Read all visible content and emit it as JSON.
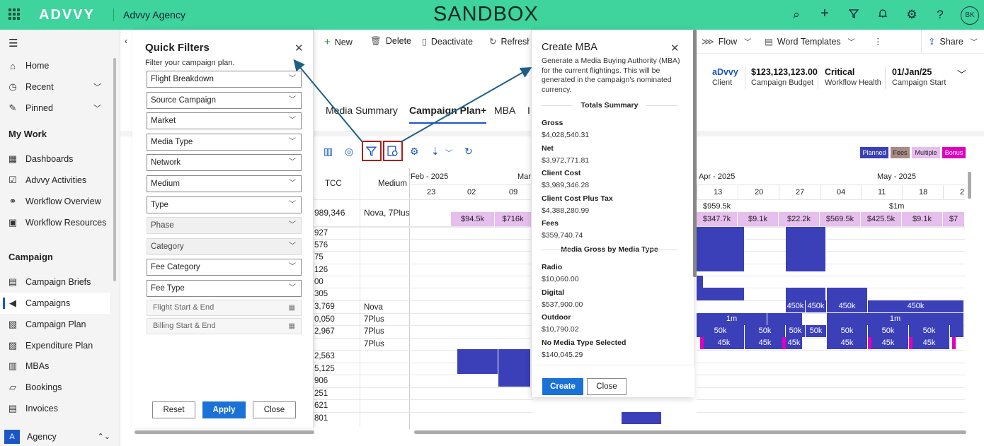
{
  "topbar": {
    "logo": "ADVVY",
    "agency": "Advvy Agency",
    "env": "SANDBOX",
    "avatar": "BK",
    "icons": [
      "search-icon",
      "add-icon",
      "filter-icon",
      "bell-icon",
      "settings-icon",
      "help-icon"
    ]
  },
  "nav": {
    "items": [
      {
        "label": "Home",
        "icon": "⌂"
      },
      {
        "label": "Recent",
        "icon": "◷"
      },
      {
        "label": "Pinned",
        "icon": "✎"
      }
    ],
    "my_work": "My Work",
    "work_items": [
      {
        "label": "Dashboards",
        "icon": "▦"
      },
      {
        "label": "Advvy Activities",
        "icon": "☑"
      },
      {
        "label": "Workflow Overview",
        "icon": "⚭"
      },
      {
        "label": "Workflow Resources",
        "icon": "▣"
      }
    ],
    "campaign": "Campaign",
    "campaign_items": [
      {
        "label": "Campaign Briefs",
        "icon": "▤"
      },
      {
        "label": "Campaigns",
        "icon": "📢"
      },
      {
        "label": "Campaign Plan",
        "icon": "▧"
      },
      {
        "label": "Expenditure Plan",
        "icon": "▨"
      },
      {
        "label": "MBAs",
        "icon": "▥"
      },
      {
        "label": "Bookings",
        "icon": "▱"
      },
      {
        "label": "Invoices",
        "icon": "▤"
      }
    ],
    "area": "Agency",
    "area_letter": "A"
  },
  "quick_filters": {
    "title": "Quick Filters",
    "subtitle": "Filter your campaign plan.",
    "selects": [
      "Flight Breakdown",
      "Source Campaign",
      "Market",
      "Media Type",
      "Network",
      "Medium",
      "Type",
      "Phase",
      "Category",
      "Fee Category",
      "Fee Type"
    ],
    "dates": [
      "Flight Start & End",
      "Billing Start & End"
    ],
    "reset": "Reset",
    "apply": "Apply",
    "close": "Close"
  },
  "commands": {
    "new": "New",
    "delete": "Delete",
    "deactivate": "Deactivate",
    "refresh": "Refresh",
    "flow": "Flow",
    "word": "Word Templates",
    "share": "Share"
  },
  "header_fields": [
    {
      "value": "aDvvy",
      "label": "Client"
    },
    {
      "value": "$123,123,123.00",
      "label": "Campaign Budget"
    },
    {
      "value": "Critical",
      "label": "Workflow Health"
    },
    {
      "value": "01/Jan/25",
      "label": "Campaign Start"
    }
  ],
  "tabs": [
    "Media Summary",
    "Campaign Plan+",
    "MBA",
    "I"
  ],
  "grid": {
    "col_tcc": "TCC",
    "col_medium": "Medium",
    "tcc": [
      "989,346",
      "927",
      "576",
      "75",
      "126",
      "00",
      "305",
      "3,769",
      "0,050",
      "2,967",
      "",
      "2,563",
      "5,125",
      "906",
      "251",
      "621",
      "801"
    ],
    "medium": [
      "Nova, 7Plus",
      "",
      "",
      "",
      "",
      "",
      "",
      "Nova",
      "7Plus",
      "7Plus",
      "7Plus",
      "",
      "",
      "",
      "",
      "",
      ""
    ],
    "months_left": [
      "Feb - 2025",
      "Mar"
    ],
    "weeks_left": [
      "23",
      "02",
      "09"
    ],
    "months_right": [
      "Apr - 2025",
      "May - 2025"
    ],
    "weeks_right": [
      "13",
      "20",
      "27",
      "04",
      "11",
      "18",
      "2"
    ],
    "fees_left": [
      "$94.5k",
      "$716k"
    ],
    "total_right": [
      "$959.5k",
      "$1m"
    ],
    "fees_right": [
      "$347.7k",
      "$9.1k",
      "$22.2k",
      "$569.5k",
      "$425.5k",
      "$9.1k",
      "$7"
    ],
    "row_450": [
      "450k",
      "450k",
      "450k",
      "450k"
    ],
    "row_1m": [
      "1m",
      "1m"
    ],
    "row_50": [
      "50k",
      "50k",
      "50k",
      "50k",
      "50k",
      "50k",
      "50k"
    ],
    "row_45": [
      "45k",
      "45k",
      "45k",
      "45k",
      "45k",
      "45k"
    ],
    "legend": [
      "Planned",
      "Fees",
      "Multiple",
      "Bonus"
    ],
    "legend_colors": [
      "#3b3fb8",
      "#a88b84",
      "#e6bfee",
      "#e000c0"
    ]
  },
  "mba": {
    "title": "Create MBA",
    "desc": "Generate a Media Buying Authority (MBA) for the current flightings. This will be generated in the campaign's nominated currency.",
    "totals_header": "Totals Summary",
    "totals": [
      {
        "label": "Gross",
        "value": "$4,028,540.31"
      },
      {
        "label": "Net",
        "value": "$3,972,771.81"
      },
      {
        "label": "Client Cost",
        "value": "$3,989,346.28"
      },
      {
        "label": "Client Cost Plus Tax",
        "value": "$4,388,280.99"
      },
      {
        "label": "Fees",
        "value": "$359,740.74"
      }
    ],
    "media_header": "Media Gross by Media Type",
    "media": [
      {
        "label": "Radio",
        "value": "$10,060.00"
      },
      {
        "label": "Digital",
        "value": "$537,900.00"
      },
      {
        "label": "Outdoor",
        "value": "$10,790.02"
      },
      {
        "label": "No Media Type Selected",
        "value": "$140,045.29"
      }
    ],
    "create": "Create",
    "close": "Close"
  }
}
